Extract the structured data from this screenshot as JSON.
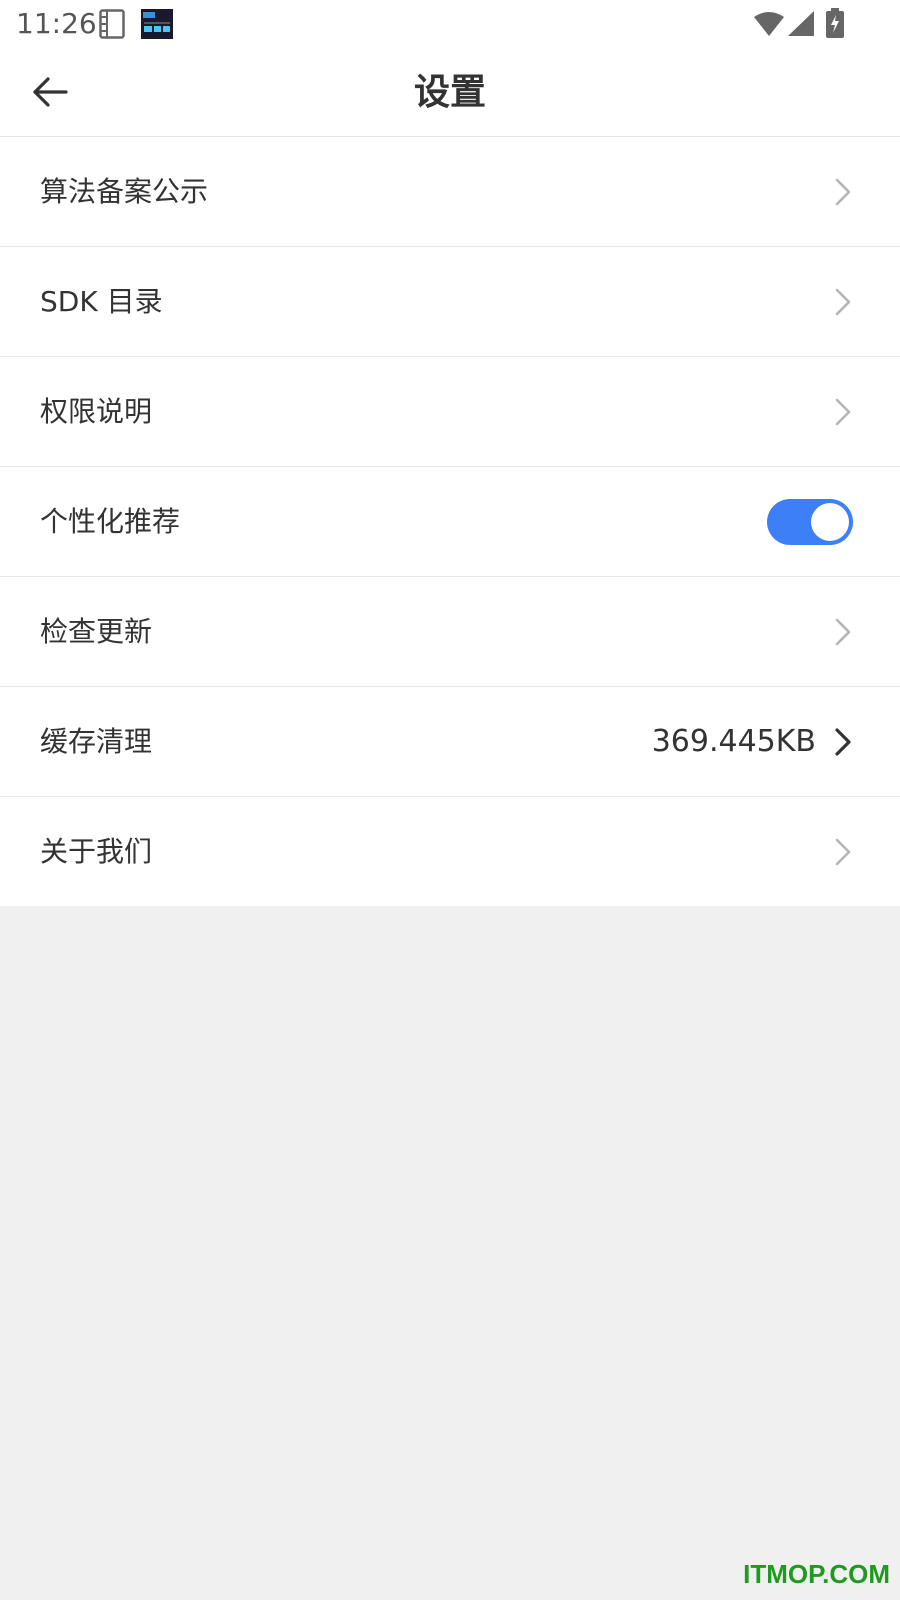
{
  "status_bar": {
    "time": "11:26",
    "icons": [
      "notebook-icon",
      "clock-widget-icon",
      "wifi-icon",
      "signal-icon",
      "battery-charging-icon"
    ]
  },
  "header": {
    "back_icon": "arrow-left-icon",
    "title": "设置"
  },
  "settings": {
    "items": [
      {
        "label": "算法备案公示"
      },
      {
        "label": "SDK 目录"
      },
      {
        "label": "权限说明"
      },
      {
        "label": "个性化推荐",
        "toggle_on": true
      },
      {
        "label": "检查更新"
      },
      {
        "label": "缓存清理",
        "value": "369.445KB"
      },
      {
        "label": "关于我们"
      }
    ]
  },
  "colors": {
    "toggle_accent": "#3d7ff6",
    "background": "#f0f0f0"
  },
  "watermark": "ITMOP.COM"
}
